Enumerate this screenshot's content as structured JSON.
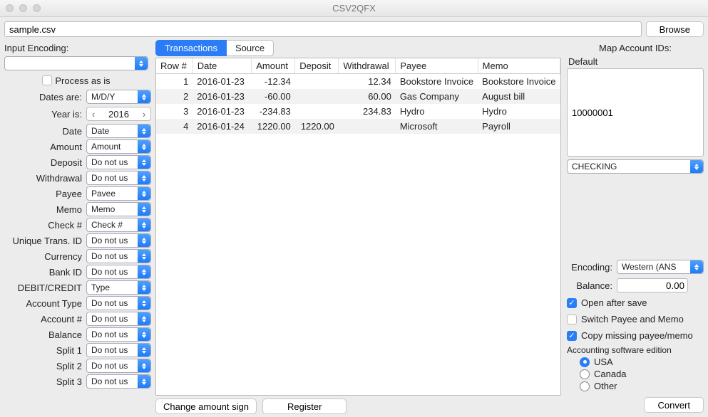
{
  "window": {
    "title": "CSV2QFX"
  },
  "file": {
    "path": "sample.csv",
    "browse": "Browse"
  },
  "left": {
    "input_encoding_label": "Input Encoding:",
    "encoding_value": "",
    "process_as_is": "Process as is",
    "dates_are_label": "Dates are:",
    "dates_are_value": "M/D/Y",
    "year_is_label": "Year is:",
    "year_is_value": "2016",
    "rows": [
      {
        "label": "Date",
        "value": "Date"
      },
      {
        "label": "Amount",
        "value": "Amount"
      },
      {
        "label": "Deposit",
        "value": "Do not us"
      },
      {
        "label": "Withdrawal",
        "value": "Do not us"
      },
      {
        "label": "Payee",
        "value": "Pavee"
      },
      {
        "label": "Memo",
        "value": "Memo"
      },
      {
        "label": "Check #",
        "value": "Check #"
      },
      {
        "label": "Unique Trans. ID",
        "value": "Do not us"
      },
      {
        "label": "Currency",
        "value": "Do not us"
      },
      {
        "label": "Bank ID",
        "value": "Do not us"
      },
      {
        "label": "DEBIT/CREDIT",
        "value": "Type"
      },
      {
        "label": "Account Type",
        "value": "Do not us"
      },
      {
        "label": "Account #",
        "value": "Do not us"
      },
      {
        "label": "Balance",
        "value": "Do not us"
      },
      {
        "label": "Split 1",
        "value": "Do not us"
      },
      {
        "label": "Split 2",
        "value": "Do not us"
      },
      {
        "label": "Split 3",
        "value": "Do not us"
      }
    ]
  },
  "tabs": {
    "transactions": "Transactions",
    "source": "Source"
  },
  "table": {
    "headers": [
      "Row #",
      "Date",
      "Amount",
      "Deposit",
      "Withdrawal",
      "Payee",
      "Memo"
    ],
    "rows": [
      {
        "n": "1",
        "date": "2016-01-23",
        "amount": "-12.34",
        "deposit": "",
        "withdrawal": "12.34",
        "payee": "Bookstore Invoice",
        "memo": "Bookstore Invoice"
      },
      {
        "n": "2",
        "date": "2016-01-23",
        "amount": "-60.00",
        "deposit": "",
        "withdrawal": "60.00",
        "payee": "Gas Company",
        "memo": "August bill"
      },
      {
        "n": "3",
        "date": "2016-01-23",
        "amount": "-234.83",
        "deposit": "",
        "withdrawal": "234.83",
        "payee": "Hydro",
        "memo": "Hydro"
      },
      {
        "n": "4",
        "date": "2016-01-24",
        "amount": "1220.00",
        "deposit": "1220.00",
        "withdrawal": "",
        "payee": "Microsoft",
        "memo": "Payroll"
      }
    ]
  },
  "bottom": {
    "change_sign": "Change amount sign",
    "register": "Register",
    "convert": "Convert"
  },
  "right": {
    "title": "Map Account IDs:",
    "default_label": "Default",
    "account_id": "10000001",
    "account_type": "CHECKING",
    "encoding_label": "Encoding:",
    "encoding_value": "Western (ANS",
    "balance_label": "Balance:",
    "balance_value": "0.00",
    "open_after_save": "Open after save",
    "switch_payee_memo": "Switch Payee and Memo",
    "copy_missing": "Copy missing payee/memo",
    "software_label": "Accounting software edition",
    "radio": {
      "usa": "USA",
      "canada": "Canada",
      "other": "Other"
    }
  }
}
